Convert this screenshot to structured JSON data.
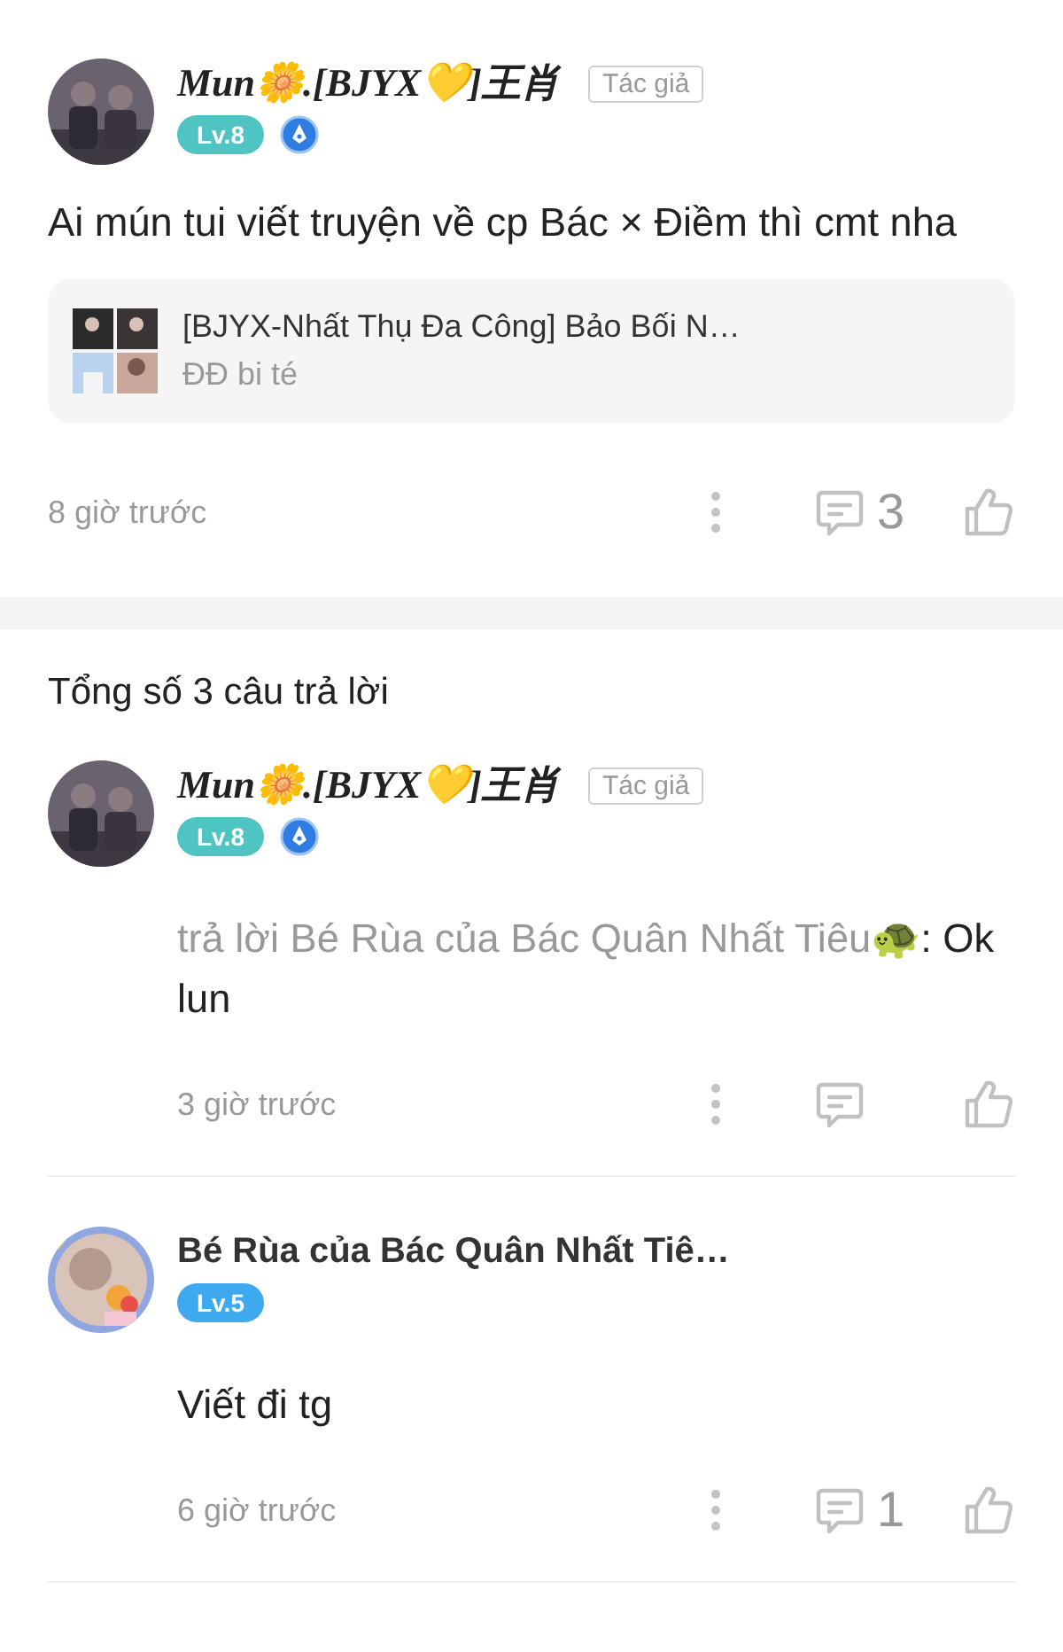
{
  "post": {
    "author": {
      "name": "Mun🌼.[BJYX💛]王肖",
      "fancy": true,
      "author_tag": "Tác giả",
      "level": {
        "label": "Lv.8",
        "color": "#4fc4c2"
      },
      "verified": true
    },
    "text": "Ai mún tui viết truyện về cp Bác × Điềm thì cmt nha",
    "book": {
      "title": "[BJYX-Nhất Thụ Đa Công] Bảo Bối N…",
      "author": "ĐĐ bi té"
    },
    "time": "8 giờ trước",
    "reply_count": "3"
  },
  "replies_header": "Tổng số 3 câu trả lời",
  "replies": [
    {
      "author": {
        "name": "Mun🌼.[BJYX💛]王肖",
        "fancy": true,
        "author_tag": "Tác giả",
        "level": {
          "label": "Lv.8",
          "color": "#4fc4c2"
        },
        "verified": true
      },
      "reply_to": "trả lời Bé Rùa của Bác Quân Nhất Tiêu🐢",
      "text": ": Ok lun",
      "time": "3 giờ trước"
    },
    {
      "author": {
        "name": "Bé Rùa của Bác Quân Nhất Tiê…",
        "fancy": false,
        "level": {
          "label": "Lv.5",
          "color": "#3fa9f0"
        },
        "verified": false
      },
      "text": "Viết đi tg",
      "time": "6 giờ trước",
      "reply_count": "1"
    }
  ]
}
